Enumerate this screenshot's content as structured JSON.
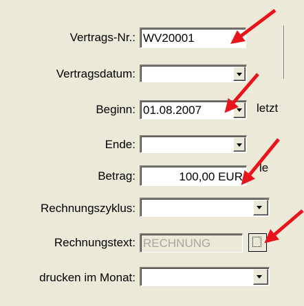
{
  "form": {
    "vertragsnr": {
      "label": "Vertrags-Nr.:",
      "value": "WV20001"
    },
    "vertragsdatum": {
      "label": "Vertragsdatum:",
      "value": ""
    },
    "beginn": {
      "label": "Beginn:",
      "value": "01.08.2007"
    },
    "ende": {
      "label": "Ende:",
      "value": ""
    },
    "betrag": {
      "label": "Betrag:",
      "value": "100,00 EUR"
    },
    "rechnungszyklus": {
      "label": "Rechnungszyklus:",
      "value": ""
    },
    "rechnungstext": {
      "label": "Rechnungstext:",
      "value": "RECHNUNG"
    },
    "drucken": {
      "label": "drucken im Monat:",
      "value": ""
    }
  },
  "side": {
    "letzt": "letzt",
    "le": "le"
  },
  "colors": {
    "arrow": "#e8141c",
    "background": "#ece9d8"
  },
  "icons": [
    "dropdown-arrow-icon",
    "ellipsis-dots-icon",
    "red-annotation-arrow"
  ]
}
